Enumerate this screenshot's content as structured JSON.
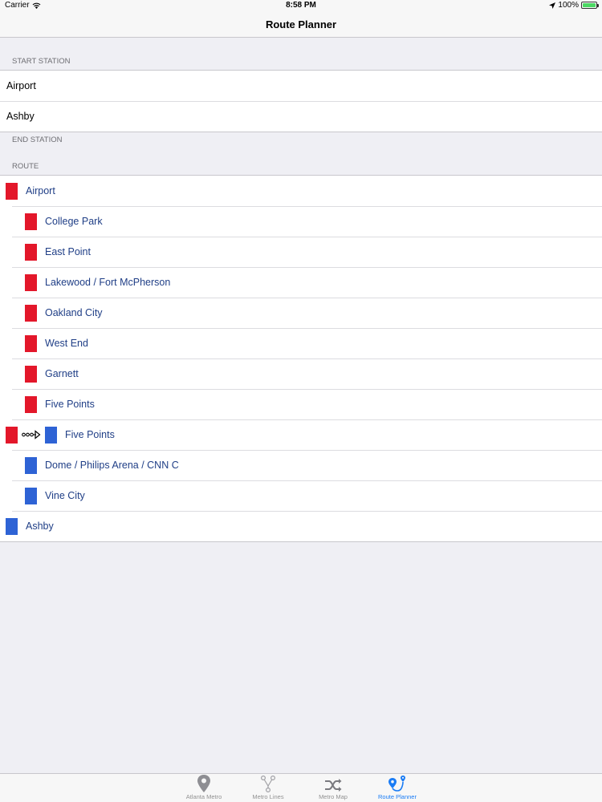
{
  "status_bar": {
    "carrier": "Carrier",
    "time": "8:58 PM",
    "battery": "100%"
  },
  "nav": {
    "title": "Route Planner"
  },
  "start_section": {
    "header": "START STATION",
    "items": [
      "Airport",
      "Ashby"
    ]
  },
  "end_section": {
    "header": "END STATION"
  },
  "route_section": {
    "header": "ROUTE",
    "items": [
      {
        "label": "Airport",
        "line": "red",
        "indent": 0
      },
      {
        "label": "College Park",
        "line": "red",
        "indent": 1
      },
      {
        "label": "East Point",
        "line": "red",
        "indent": 1
      },
      {
        "label": "Lakewood / Fort McPherson",
        "line": "red",
        "indent": 1
      },
      {
        "label": "Oakland City",
        "line": "red",
        "indent": 1
      },
      {
        "label": "West End",
        "line": "red",
        "indent": 1
      },
      {
        "label": "Garnett",
        "line": "red",
        "indent": 1
      },
      {
        "label": "Five Points",
        "line": "red",
        "indent": 1
      },
      {
        "label": "Five Points",
        "line": "blue",
        "from_line": "red",
        "transfer": true
      },
      {
        "label": "Dome / Philips Arena / CNN C",
        "line": "blue",
        "indent": 1
      },
      {
        "label": "Vine City",
        "line": "blue",
        "indent": 1
      },
      {
        "label": "Ashby",
        "line": "blue",
        "indent": 0
      }
    ]
  },
  "tabs": [
    {
      "label": "Atlanta Metro",
      "icon": "map-pin-icon",
      "active": false
    },
    {
      "label": "Metro Lines",
      "icon": "metro-lines-icon",
      "active": false
    },
    {
      "label": "Metro Map",
      "icon": "shuffle-icon",
      "active": false
    },
    {
      "label": "Route Planner",
      "icon": "route-planner-icon",
      "active": true
    }
  ],
  "colors": {
    "red_line": "#e3172a",
    "blue_line": "#2e63d5",
    "accent": "#1a7cf5",
    "route_text": "#1f3e86"
  }
}
